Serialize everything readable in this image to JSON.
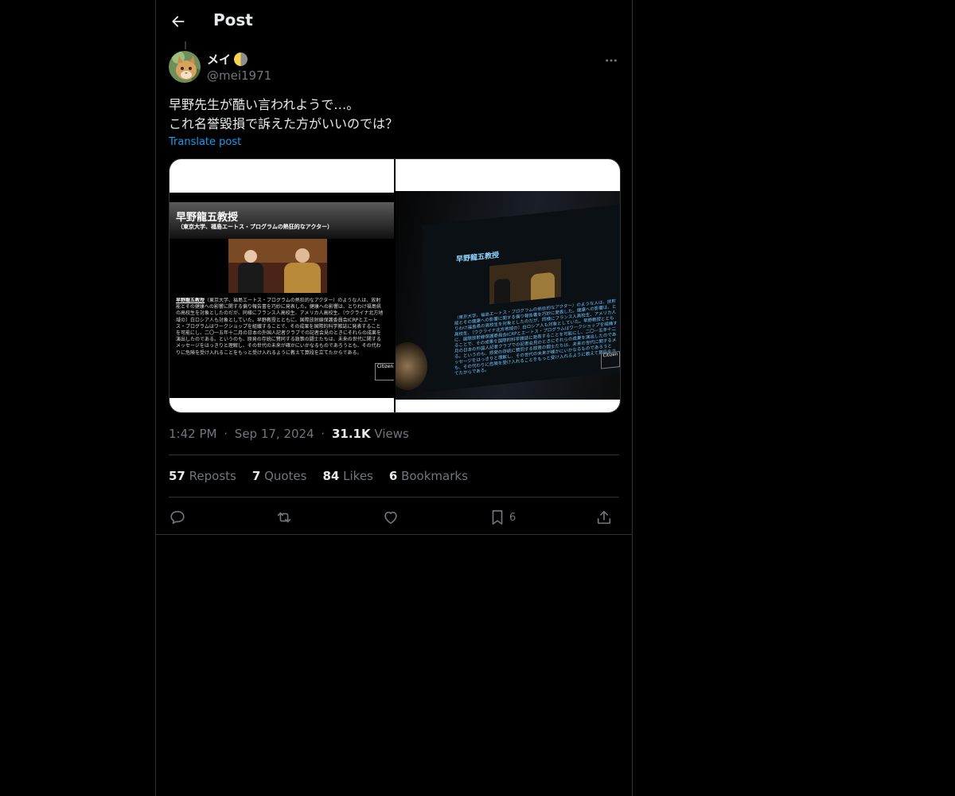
{
  "header": {
    "title": "Post"
  },
  "author": {
    "display_name": "メイ",
    "handle": "@mei1971"
  },
  "tweet": {
    "lines": [
      "早野先生が酷い言われようで…。",
      "これ名誉毀損で訴えた方がいいのでは？"
    ],
    "translate_label": "Translate post"
  },
  "media": {
    "slide_title": "早野龍五教授",
    "slide_subtitle": "（東京大学、福島エートス・プログラムの熱狂的なアクター）",
    "slide_body_lead": "早野龍五教授",
    "slide_body": "（東京大学、福島エートス・プログラムの熱狂的なアクター）のような人は、放射能とその健康への影響に関する偏り報告書を巧妙に発表した。健康への影響は、とりわけ福島県の高校生を対象としたのだが、同様にフランス人高校生、アメリカ人高校生、〔ウクライナ北方地域の〕白ロシア人も対象としていた。早野教授とともに、国際放射線保護委員会ICRPとエートス・プログラムはワークショップを組織することで、その成果を国際的科学雑誌に発表することを可能にし、二〇一五年十二月の日本の外国人記者クラブでの記者会見のときにそれらの成果を演出したのである。というのも、原発の存続に賛同する政策の闘士たちは、未来の世代に関するメッセージをはっきりと理解し、その世代の未来が確かにいかなるものであろうとも、その代わりに危険を受け入れることをもっと受け入れるように教えて算段を立てたからである。",
    "logo_text": "Citizen"
  },
  "meta": {
    "time": "1:42 PM",
    "date": "Sep 17, 2024",
    "views_count": "31.1K",
    "views_label": "Views"
  },
  "stats": {
    "reposts_count": "57",
    "reposts_label": "Reposts",
    "quotes_count": "7",
    "quotes_label": "Quotes",
    "likes_count": "84",
    "likes_label": "Likes",
    "bookmarks_count": "6",
    "bookmarks_label": "Bookmarks"
  },
  "actions": {
    "bookmark_count": "6"
  },
  "colors": {
    "background": "#000000",
    "text": "#e7e9ea",
    "muted": "#71767b",
    "accent": "#1d9bf0",
    "border": "#2f3336"
  },
  "icons": [
    "back-arrow-icon",
    "more-icon",
    "reply-icon",
    "repost-icon",
    "like-icon",
    "bookmark-icon",
    "share-icon"
  ]
}
